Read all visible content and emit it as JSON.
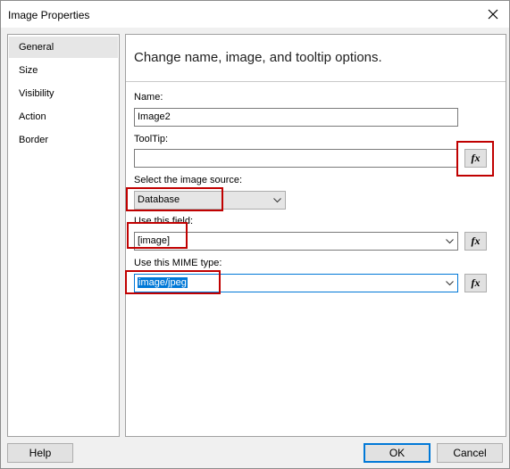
{
  "window": {
    "title": "Image Properties",
    "close_icon": "close-icon"
  },
  "sidebar": {
    "items": [
      {
        "label": "General"
      },
      {
        "label": "Size"
      },
      {
        "label": "Visibility"
      },
      {
        "label": "Action"
      },
      {
        "label": "Border"
      }
    ],
    "selected": "General"
  },
  "content": {
    "header": "Change name, image, and tooltip options.",
    "name": {
      "label": "Name:",
      "value": "Image2"
    },
    "tooltip": {
      "label": "ToolTip:",
      "value": "",
      "fx_label": "fx"
    },
    "source": {
      "label": "Select the image source:",
      "value": "Database"
    },
    "field": {
      "label": "Use this field:",
      "value": "[image]",
      "fx_label": "fx"
    },
    "mime": {
      "label": "Use this MIME type:",
      "value": "image/jpeg",
      "fx_label": "fx"
    }
  },
  "footer": {
    "help": "Help",
    "ok": "OK",
    "cancel": "Cancel"
  },
  "colors": {
    "highlight_box": "#c00000",
    "selection": "#0078d7"
  }
}
